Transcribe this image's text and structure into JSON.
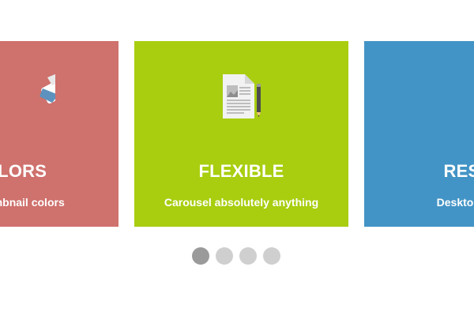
{
  "colors": {
    "card_red": "#cf716d",
    "card_green": "#a8ce0f",
    "card_blue": "#4394c6",
    "dot_active": "#9a9a9a",
    "dot_inactive": "#cfcfcf"
  },
  "carousel": {
    "cards": [
      {
        "title": "OLORS",
        "subtitle": "e thumbnail colors",
        "icon": "paint-roller-icon"
      },
      {
        "title": "FLEXIBLE",
        "subtitle": "Carousel absolutely anything",
        "icon": "document-icon"
      },
      {
        "title": "RESPO",
        "subtitle": "Desktops, tabl",
        "icon": "monitor-icon"
      }
    ],
    "dots": {
      "count": 4,
      "active_index": 0
    }
  }
}
